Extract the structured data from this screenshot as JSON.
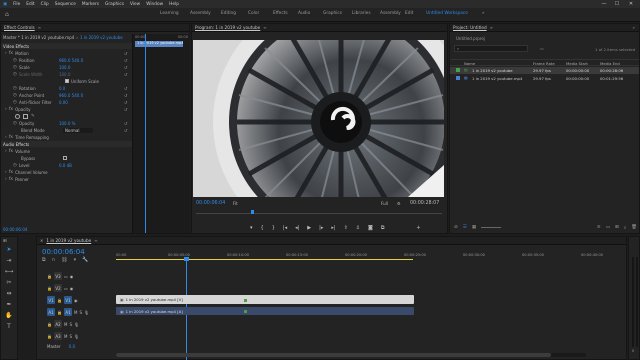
{
  "menu": [
    "File",
    "Edit",
    "Clip",
    "Sequence",
    "Markers",
    "Graphics",
    "View",
    "Window",
    "Help"
  ],
  "window_controls": {
    "minimize": "—",
    "maximize": "☐",
    "close": "✕"
  },
  "workspaces": [
    "Learning",
    "Assembly",
    "Editing",
    "Color",
    "Effects",
    "Audio",
    "Graphics",
    "Libraries",
    "Assembly",
    "Edit",
    "Untitled Workspace"
  ],
  "workspace_more": "»",
  "effect_controls": {
    "tab": "Effect Controls",
    "source": "Master * 1 in 2019 v2 youtube.mp4",
    "sequence": "1 in 2019 v2 youtube",
    "clip_label": "1 in 2019 v2 youtube.mp4",
    "section_video": "Video Effects",
    "rows": [
      {
        "name": "Motion",
        "value": ""
      },
      {
        "name": "Position",
        "value": "960.0   540.0"
      },
      {
        "name": "Scale",
        "value": "100.0"
      },
      {
        "name": "Scale Width",
        "value": "100.0"
      },
      {
        "name": "Uniform Scale",
        "value": ""
      },
      {
        "name": "Rotation",
        "value": "0.0"
      },
      {
        "name": "Anchor Point",
        "value": "960.0   540.0"
      },
      {
        "name": "Anti-flicker Filter",
        "value": "0.00"
      },
      {
        "name": "Opacity",
        "value": ""
      },
      {
        "name": "Opacity",
        "value": "100.0 %"
      },
      {
        "name": "Blend Mode",
        "value": "Normal"
      },
      {
        "name": "Time Remapping",
        "value": ""
      },
      {
        "name": "Audio Effects",
        "value": ""
      },
      {
        "name": "Volume",
        "value": ""
      },
      {
        "name": "Bypass",
        "value": ""
      },
      {
        "name": "Level",
        "value": "0.0 dB"
      },
      {
        "name": "Channel Volume",
        "value": ""
      },
      {
        "name": "Panner",
        "value": ""
      }
    ],
    "mini_clip": "1 in 2019 v2 youtube.mp4",
    "mini_ruler": [
      "00:00",
      "00:00"
    ],
    "timecode": "00:00:06:04"
  },
  "program": {
    "title": "Program: 1 in 2019 v2 youtube",
    "timecode": "00:00:06:04",
    "fit": "Fit",
    "quality": "Full",
    "duration": "00:00:28:07"
  },
  "project": {
    "title": "Project: Untitled",
    "file": "Untitled.prproj",
    "items_count": "1 of 2 items selected",
    "columns": [
      "Name",
      "Frame Rate",
      "Media Start",
      "Media End"
    ],
    "rows": [
      {
        "name": "1 in 2019 v2 youtube",
        "fps": "29.97 fps",
        "start": "00:00:00:00",
        "end": "00:00:28:06",
        "color": "#48a148"
      },
      {
        "name": "1 in 2019 v2 youtube.mp4",
        "fps": "29.97 fps",
        "start": "00:00:00:00",
        "end": "00:01:29:56",
        "color": "#4a7fd0"
      }
    ]
  },
  "timeline": {
    "sequence_tab": "1 in 2019 v2 youtube",
    "timecode": "00:00:06:04",
    "ruler": [
      "00:00",
      "00:00:05:00",
      "00:00:10:00",
      "00:00:15:00",
      "00:00:20:00",
      "00:00:25:00",
      "00:00:30:00",
      "00:00:35:00",
      "00:00:40:00"
    ],
    "tracks": [
      "V3",
      "V2",
      "V1",
      "A1",
      "A2",
      "A3"
    ],
    "master_label": "Master",
    "master_value": "0.0",
    "clip_video": "1 in 2019 v2 youtube.mp4 [V]",
    "clip_audio": "1 in 2019 v2 youtube.mp4 [A]",
    "zero_text": "0"
  },
  "colors": {
    "accent": "#2d8ceb",
    "video_clip": "#d6d6d6",
    "audio_clip": "#3a4a6a",
    "highlight": "#e6d13a"
  }
}
